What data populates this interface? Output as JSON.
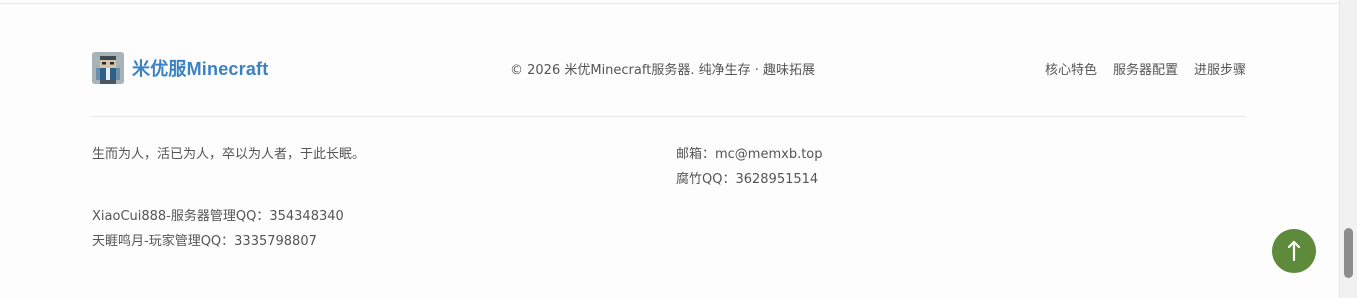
{
  "brand": {
    "name": "米优服Minecraft",
    "logo_icon": "pixel-character-logo-icon"
  },
  "copyright": "© 2026 米优Minecraft服务器. 纯净生存 · 趣味拓展",
  "nav": {
    "items": [
      "核心特色",
      "服务器配置",
      "进服步骤"
    ]
  },
  "info": {
    "motto": "生而为人，活已为人，卒以为人者，于此长眠。",
    "email": "邮箱：mc@memxb.top",
    "fuzhu_qq": "腐竹QQ：3628951514",
    "admin_server": "XiaoCui888-服务器管理QQ：354348340",
    "admin_player": "天睚鸣月-玩家管理QQ：3335798807"
  },
  "scroll_top": {
    "icon": "arrow-up-icon",
    "color": "#5e8a3b"
  },
  "colors": {
    "brand": "#3b82c4",
    "text": "#555555"
  }
}
